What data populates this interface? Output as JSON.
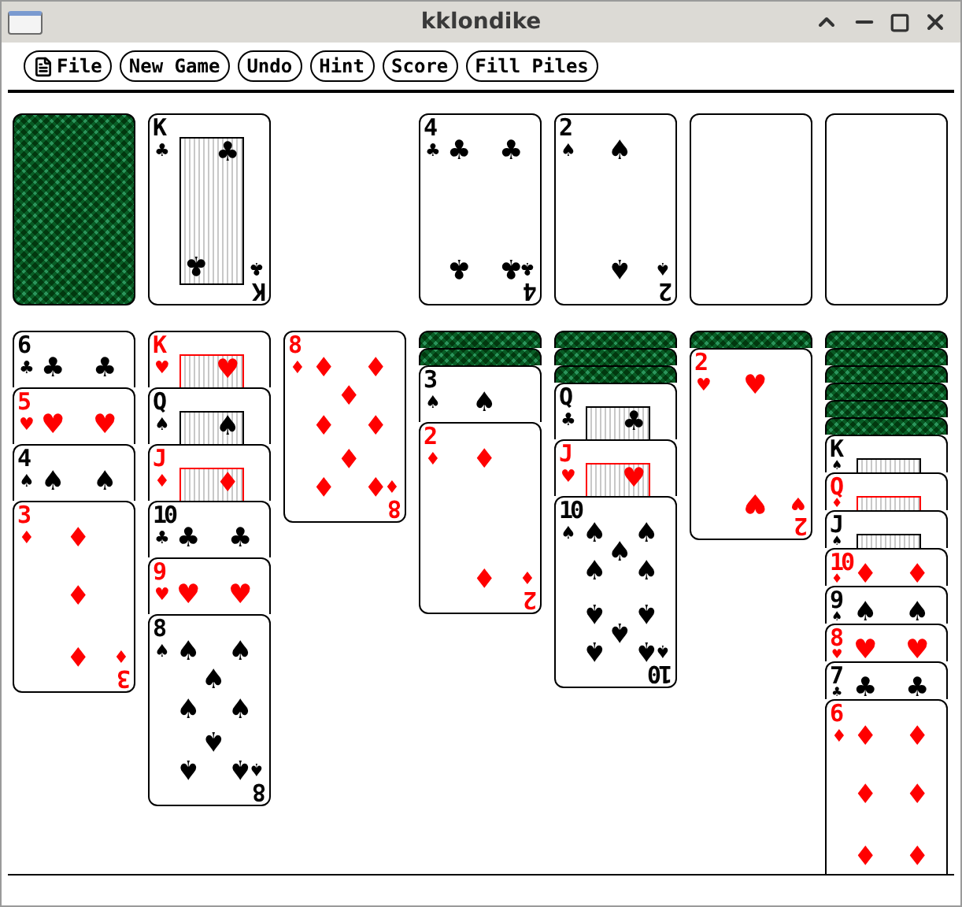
{
  "window": {
    "title": "kklondike"
  },
  "toolbar": [
    {
      "label": "File",
      "kind": "menu"
    },
    {
      "label": "New Game",
      "kind": "action"
    },
    {
      "label": "Undo",
      "kind": "action"
    },
    {
      "label": "Hint",
      "kind": "action"
    },
    {
      "label": "Score",
      "kind": "action"
    },
    {
      "label": "Fill Piles",
      "kind": "action"
    }
  ],
  "waste": {
    "face_up": true,
    "rank": "K",
    "suit": "♣",
    "color": "#000000",
    "kind": "court",
    "bottom_rank": "K",
    "bottom_suit": "♣"
  },
  "foundations": [
    {
      "empty": false,
      "card": {
        "face_up": true,
        "rank": "4",
        "suit": "♣",
        "color": "#000000",
        "kind": "four",
        "bottom_rank": "4",
        "bottom_suit": "♣"
      }
    },
    {
      "empty": false,
      "card": {
        "face_up": true,
        "rank": "2",
        "suit": "♠",
        "color": "#000000",
        "kind": "two",
        "bottom_rank": "2",
        "bottom_suit": "♠"
      }
    },
    {
      "empty": true
    },
    {
      "empty": true
    }
  ],
  "tableau": [
    {
      "compact": false,
      "cards": [
        {
          "face_up": true,
          "rank": "6",
          "suit": "♣",
          "color": "#000000",
          "kind": "six"
        },
        {
          "face_up": true,
          "rank": "5",
          "suit": "♥",
          "color": "#ff0000",
          "kind": "five"
        },
        {
          "face_up": true,
          "rank": "4",
          "suit": "♠",
          "color": "#000000",
          "kind": "four"
        },
        {
          "face_up": true,
          "rank": "3",
          "suit": "♦",
          "color": "#ff0000",
          "kind": "three",
          "bottom_rank": "3",
          "bottom_suit": "♦"
        }
      ]
    },
    {
      "compact": false,
      "cards": [
        {
          "face_up": true,
          "rank": "K",
          "suit": "♥",
          "color": "#ff0000",
          "kind": "court"
        },
        {
          "face_up": true,
          "rank": "Q",
          "suit": "♠",
          "color": "#000000",
          "kind": "court"
        },
        {
          "face_up": true,
          "rank": "J",
          "suit": "♦",
          "color": "#ff0000",
          "kind": "court"
        },
        {
          "face_up": true,
          "rank": "10",
          "suit": "♣",
          "color": "#000000",
          "kind": "ten"
        },
        {
          "face_up": true,
          "rank": "9",
          "suit": "♥",
          "color": "#ff0000",
          "kind": "nine"
        },
        {
          "face_up": true,
          "rank": "8",
          "suit": "♠",
          "color": "#000000",
          "kind": "eight",
          "bottom_rank": "8",
          "bottom_suit": "♠"
        }
      ]
    },
    {
      "cards": [
        {
          "face_up": true,
          "rank": "8",
          "suit": "♦",
          "color": "#ff0000",
          "kind": "eight",
          "bottom_rank": "8",
          "bottom_suit": "♦"
        }
      ]
    },
    {
      "compact": false,
      "cards": [
        {
          "face_up": false
        },
        {
          "face_up": false
        },
        {
          "face_up": true,
          "rank": "3",
          "suit": "♠",
          "color": "#000000",
          "kind": "three"
        },
        {
          "face_up": true,
          "rank": "2",
          "suit": "♦",
          "color": "#ff0000",
          "kind": "two",
          "bottom_rank": "2",
          "bottom_suit": "♦"
        }
      ]
    },
    {
      "compact": false,
      "cards": [
        {
          "face_up": false
        },
        {
          "face_up": false
        },
        {
          "face_up": false
        },
        {
          "face_up": true,
          "rank": "Q",
          "suit": "♣",
          "color": "#000000",
          "kind": "court"
        },
        {
          "face_up": true,
          "rank": "J",
          "suit": "♥",
          "color": "#ff0000",
          "kind": "court"
        },
        {
          "face_up": true,
          "rank": "10",
          "suit": "♠",
          "color": "#000000",
          "kind": "ten",
          "bottom_rank": "10",
          "bottom_suit": "♠"
        }
      ]
    },
    {
      "cards": [
        {
          "face_up": false
        },
        {
          "face_up": true,
          "rank": "2",
          "suit": "♥",
          "color": "#ff0000",
          "kind": "two",
          "bottom_rank": "2",
          "bottom_suit": "♥"
        }
      ]
    },
    {
      "compact": true,
      "cards": [
        {
          "face_up": false
        },
        {
          "face_up": false
        },
        {
          "face_up": false
        },
        {
          "face_up": false
        },
        {
          "face_up": false
        },
        {
          "face_up": false
        },
        {
          "face_up": true,
          "rank": "K",
          "suit": "♠",
          "color": "#000000",
          "kind": "court"
        },
        {
          "face_up": true,
          "rank": "Q",
          "suit": "♦",
          "color": "#ff0000",
          "kind": "court"
        },
        {
          "face_up": true,
          "rank": "J",
          "suit": "♠",
          "color": "#000000",
          "kind": "court"
        },
        {
          "face_up": true,
          "rank": "10",
          "suit": "♦",
          "color": "#ff0000",
          "kind": "ten"
        },
        {
          "face_up": true,
          "rank": "9",
          "suit": "♠",
          "color": "#000000",
          "kind": "nine"
        },
        {
          "face_up": true,
          "rank": "8",
          "suit": "♥",
          "color": "#ff0000",
          "kind": "eight"
        },
        {
          "face_up": true,
          "rank": "7",
          "suit": "♣",
          "color": "#000000",
          "kind": "seven"
        },
        {
          "face_up": true,
          "rank": "6",
          "suit": "♦",
          "color": "#ff0000",
          "kind": "six"
        }
      ]
    }
  ]
}
